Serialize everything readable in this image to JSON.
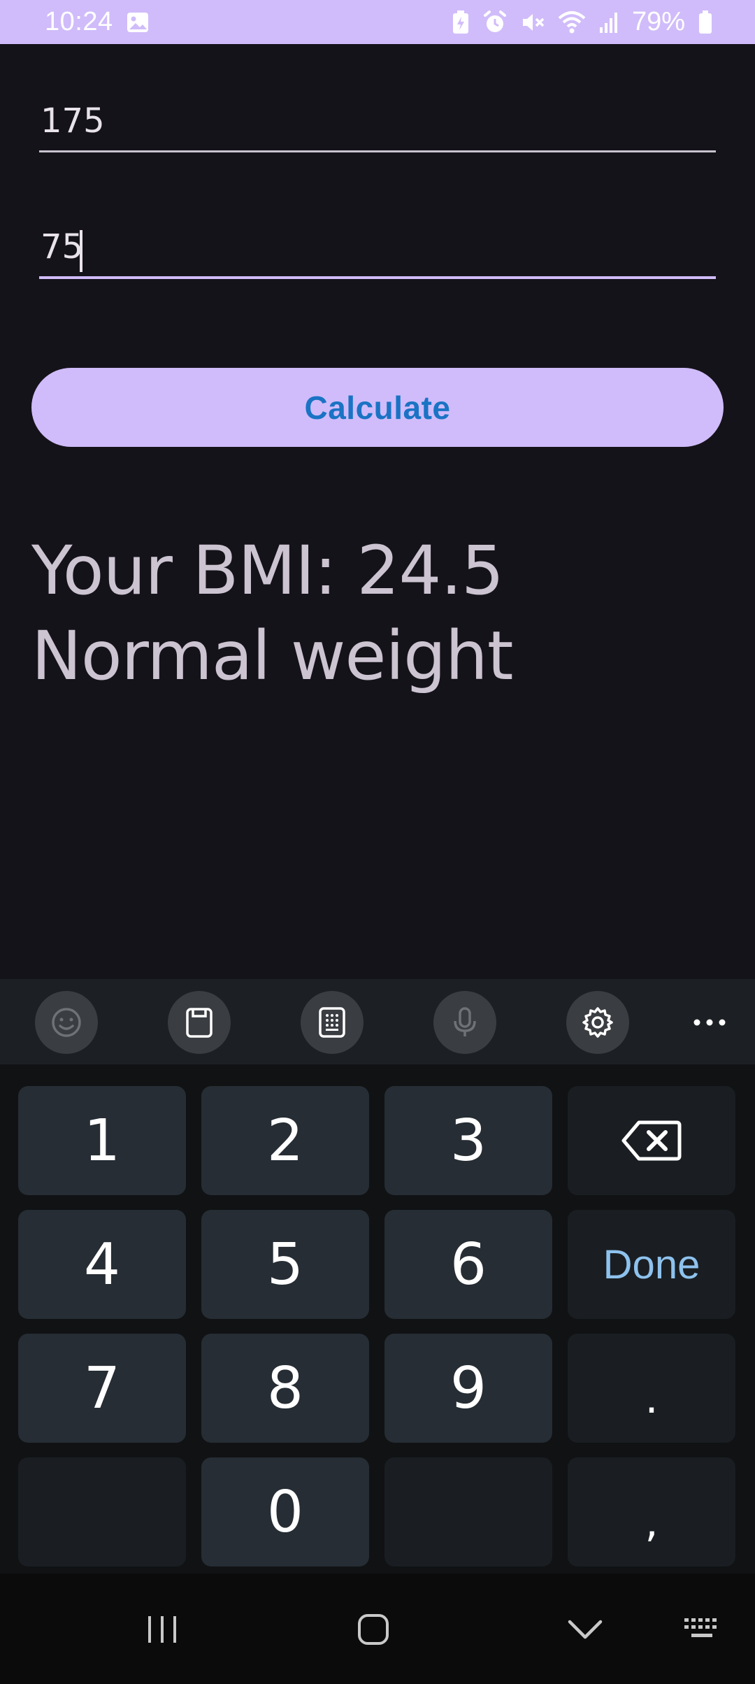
{
  "status_bar": {
    "time": "10:24",
    "battery_percent": "79%"
  },
  "form": {
    "height_value": "175",
    "weight_value": "75"
  },
  "calculate_button": {
    "label": "Calculate"
  },
  "result": {
    "bmi_line": "Your BMI: 24.5",
    "category_line": "Normal weight"
  },
  "keyboard": {
    "toolbar": [
      "emoji-icon",
      "clipboard-icon",
      "keypad-icon",
      "mic-icon",
      "settings-icon",
      "more-icon"
    ],
    "keys": {
      "k1": "1",
      "k2": "2",
      "k3": "3",
      "k4": "4",
      "k5": "5",
      "k6": "6",
      "k7": "7",
      "k8": "8",
      "k9": "9",
      "k0": "0",
      "done": "Done",
      "period": ".",
      "comma": ","
    }
  },
  "colors": {
    "accent": "#d0bcfa",
    "background": "#15131a",
    "button_text": "#1a73c4",
    "done_text": "#8ec2ee"
  }
}
